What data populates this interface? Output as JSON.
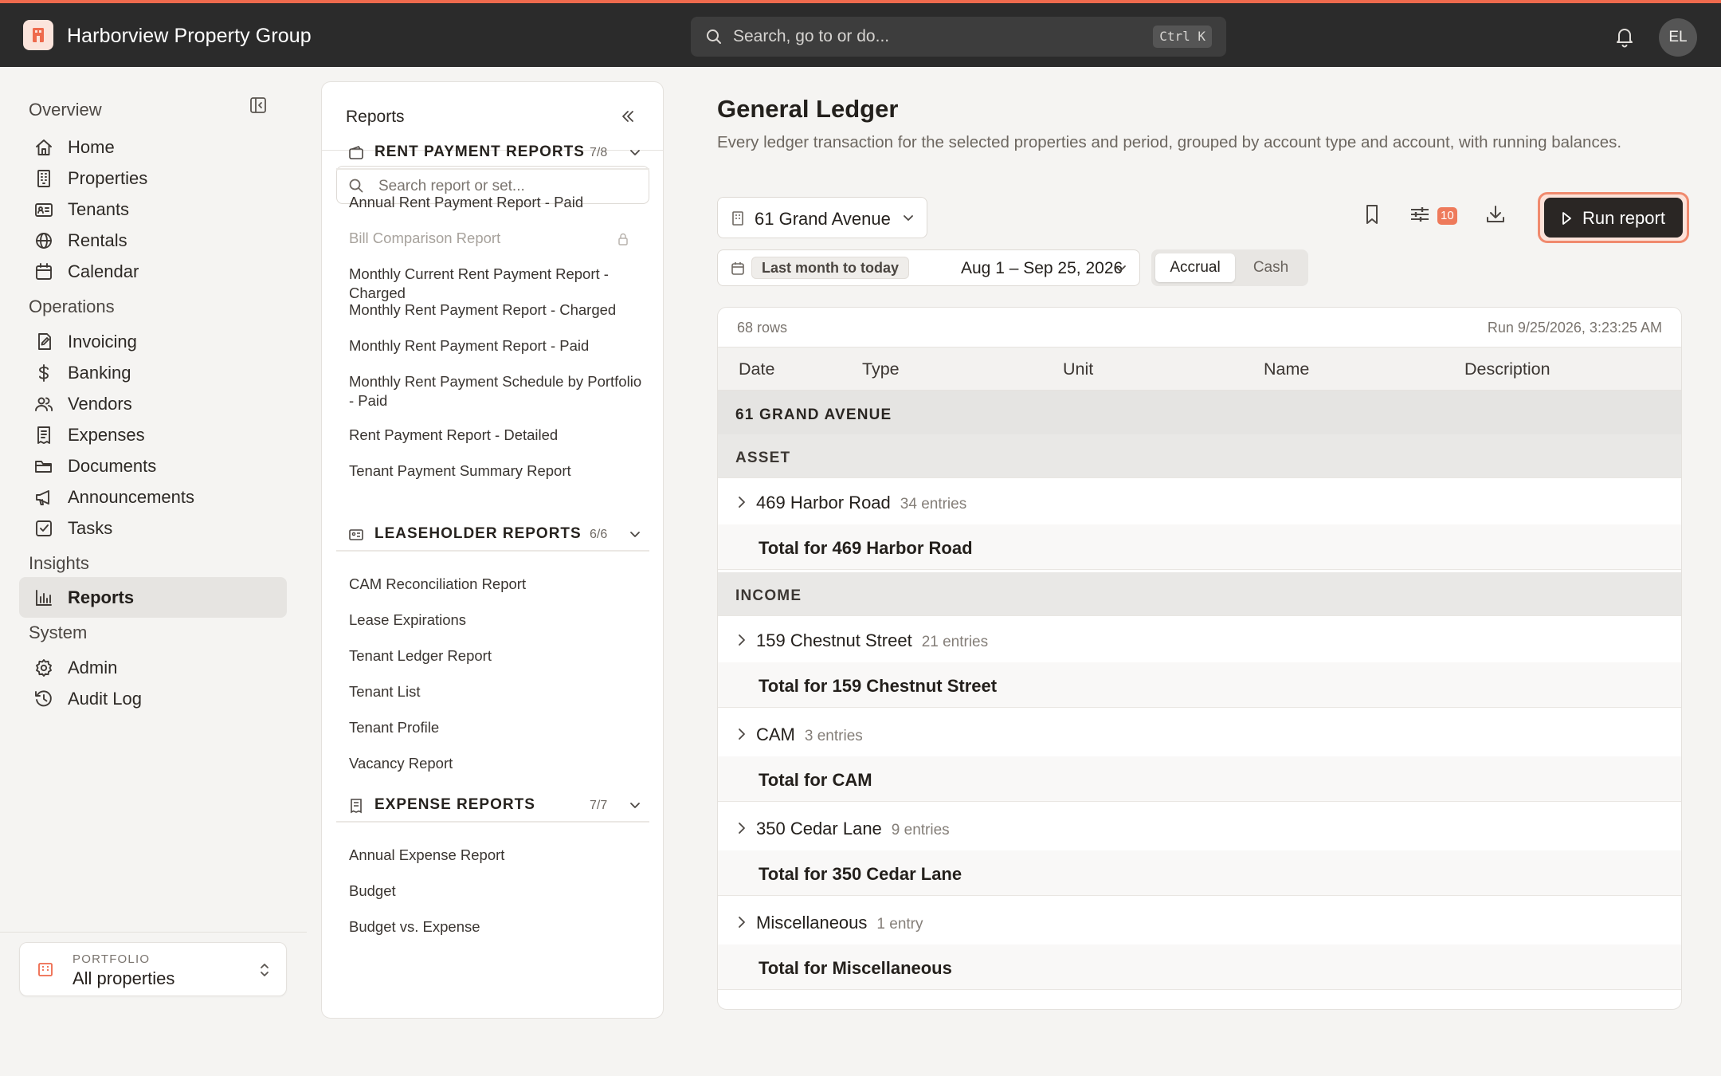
{
  "app": {
    "name": "Harborview Property Group",
    "search_placeholder": "Search, go to or do...",
    "search_shortcut": "Ctrl K",
    "user_initials": "EL",
    "accent_color": "#ee6a4d"
  },
  "sidebar": {
    "sections": [
      {
        "title": "Overview",
        "items": [
          {
            "label": "Home",
            "icon": "home-icon"
          },
          {
            "label": "Properties",
            "icon": "building-icon"
          },
          {
            "label": "Tenants",
            "icon": "id-card-icon"
          },
          {
            "label": "Rentals",
            "icon": "globe-icon"
          },
          {
            "label": "Calendar",
            "icon": "calendar-icon"
          }
        ]
      },
      {
        "title": "Operations",
        "items": [
          {
            "label": "Invoicing",
            "icon": "invoice-icon"
          },
          {
            "label": "Banking",
            "icon": "dollar-icon"
          },
          {
            "label": "Vendors",
            "icon": "users-icon"
          },
          {
            "label": "Expenses",
            "icon": "receipt-icon"
          },
          {
            "label": "Documents",
            "icon": "folder-icon"
          },
          {
            "label": "Announcements",
            "icon": "megaphone-icon"
          },
          {
            "label": "Tasks",
            "icon": "checkbox-icon"
          }
        ]
      },
      {
        "title": "Insights",
        "items": [
          {
            "label": "Reports",
            "icon": "bar-chart-icon",
            "active": true
          }
        ]
      },
      {
        "title": "System",
        "items": [
          {
            "label": "Admin",
            "icon": "gear-icon"
          },
          {
            "label": "Audit Log",
            "icon": "history-icon"
          }
        ]
      }
    ],
    "portfolio": {
      "label": "PORTFOLIO",
      "value": "All properties"
    }
  },
  "reports_panel": {
    "title": "Reports",
    "search_placeholder": "Search report or set...",
    "groups": [
      {
        "title": "RENT PAYMENT REPORTS",
        "count": "7/8",
        "items": [
          {
            "label": "Annual Rent Payment Report - Paid"
          },
          {
            "label": "Bill Comparison Report",
            "locked": true
          },
          {
            "label": "Monthly Current Rent Payment Report - Charged"
          },
          {
            "label": "Monthly Rent Payment Report - Charged"
          },
          {
            "label": "Monthly Rent Payment Report - Paid"
          },
          {
            "label": "Monthly Rent Payment Schedule by Portfolio - Paid"
          },
          {
            "label": "Rent Payment Report - Detailed"
          },
          {
            "label": "Tenant Payment Summary Report"
          }
        ]
      },
      {
        "title": "LEASEHOLDER REPORTS",
        "count": "6/6",
        "items": [
          {
            "label": "CAM Reconciliation Report"
          },
          {
            "label": "Lease Expirations"
          },
          {
            "label": "Tenant Ledger Report"
          },
          {
            "label": "Tenant List"
          },
          {
            "label": "Tenant Profile"
          },
          {
            "label": "Vacancy Report"
          }
        ]
      },
      {
        "title": "EXPENSE REPORTS",
        "count": "7/7",
        "items": [
          {
            "label": "Annual Expense Report"
          },
          {
            "label": "Budget"
          },
          {
            "label": "Budget vs. Expense"
          }
        ]
      }
    ]
  },
  "main": {
    "title": "General Ledger",
    "description": "Every ledger transaction for the selected properties and period, grouped by account type and account, with running balances.",
    "property_select": "61 Grand Avenue",
    "filter_count": "10",
    "run_button": "Run report",
    "date_preset": "Last month to today",
    "date_range": "Aug 1 – Sep 25, 2026",
    "basis_options": [
      "Accrual",
      "Cash"
    ],
    "basis_selected": "Accrual"
  },
  "report_table": {
    "rows_count": "68 rows",
    "run_timestamp": "Run 9/25/2026, 3:23:25 AM",
    "columns": [
      "Date",
      "Type",
      "Unit",
      "Name",
      "Description"
    ],
    "rows": [
      {
        "kind": "property",
        "label": "61 GRAND AVENUE"
      },
      {
        "kind": "acct-type",
        "label": "ASSET"
      },
      {
        "kind": "account",
        "label": "469 Harbor Road",
        "entries": "34 entries"
      },
      {
        "kind": "total",
        "label": "Total for 469 Harbor Road"
      },
      {
        "kind": "acct-type",
        "label": "INCOME"
      },
      {
        "kind": "account",
        "label": "159 Chestnut Street",
        "entries": "21 entries"
      },
      {
        "kind": "total",
        "label": "Total for 159 Chestnut Street"
      },
      {
        "kind": "account",
        "label": "CAM",
        "entries": "3 entries"
      },
      {
        "kind": "total",
        "label": "Total for CAM"
      },
      {
        "kind": "account",
        "label": "350 Cedar Lane",
        "entries": "9 entries"
      },
      {
        "kind": "total",
        "label": "Total for 350 Cedar Lane"
      },
      {
        "kind": "account",
        "label": "Miscellaneous",
        "entries": "1 entry"
      },
      {
        "kind": "total",
        "label": "Total for Miscellaneous"
      }
    ]
  }
}
